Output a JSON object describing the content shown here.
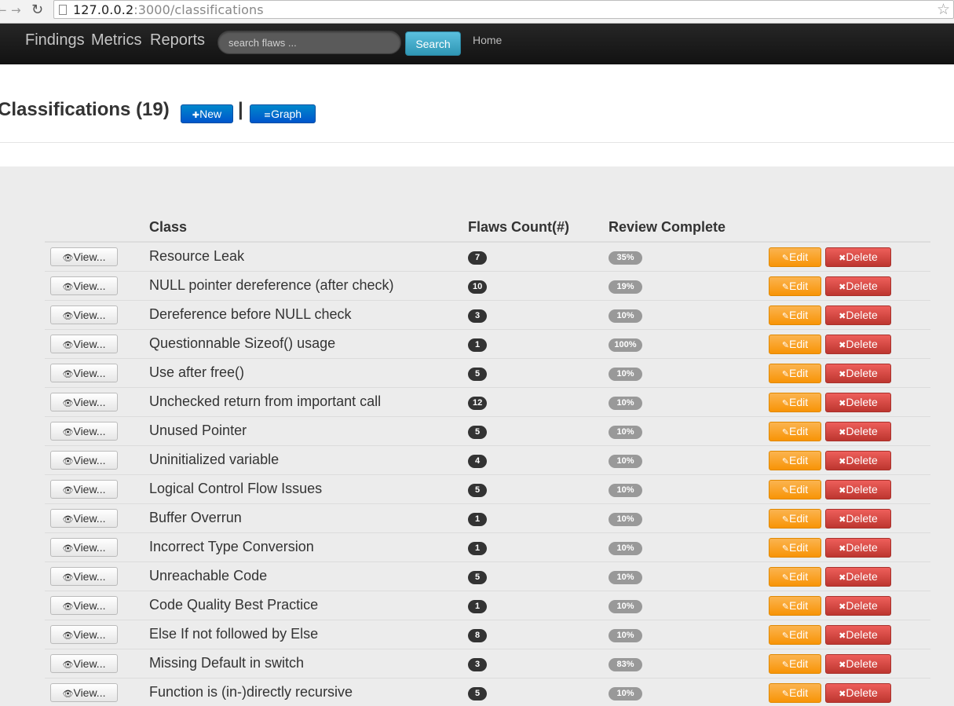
{
  "browser": {
    "url_host": "127.0.0.2",
    "url_rest": ":3000/classifications",
    "back_icon": "back-arrow-icon",
    "forward_icon": "forward-arrow-icon",
    "reload_icon": "reload-icon",
    "bookmark_icon": "star-icon"
  },
  "navbar": {
    "links": [
      "Findings",
      "Metrics",
      "Reports"
    ],
    "search_placeholder": "search flaws ...",
    "search_button": "Search",
    "home": "Home",
    "search_button_color": "#49afcd"
  },
  "header": {
    "title": "Classifications (19)",
    "new_button": "New",
    "separator": "|",
    "graph_button": "Graph",
    "button_color": "#006dcc"
  },
  "table": {
    "columns": [
      "Class",
      "Flaws Count(#)",
      "Review Complete"
    ],
    "view_label": "View...",
    "edit_label": "Edit",
    "delete_label": "Delete",
    "edit_color": "#faa732",
    "delete_color": "#da4f49",
    "rows": [
      {
        "name": "Resource Leak",
        "count": "7",
        "review": "35%"
      },
      {
        "name": "NULL pointer dereference (after check)",
        "count": "10",
        "review": "19%"
      },
      {
        "name": "Dereference before NULL check",
        "count": "3",
        "review": "10%"
      },
      {
        "name": "Questionnable Sizeof() usage",
        "count": "1",
        "review": "100%"
      },
      {
        "name": "Use after free()",
        "count": "5",
        "review": "10%"
      },
      {
        "name": "Unchecked return from important call",
        "count": "12",
        "review": "10%"
      },
      {
        "name": "Unused Pointer",
        "count": "5",
        "review": "10%"
      },
      {
        "name": "Uninitialized variable",
        "count": "4",
        "review": "10%"
      },
      {
        "name": "Logical Control Flow Issues",
        "count": "5",
        "review": "10%"
      },
      {
        "name": "Buffer Overrun",
        "count": "1",
        "review": "10%"
      },
      {
        "name": "Incorrect Type Conversion",
        "count": "1",
        "review": "10%"
      },
      {
        "name": "Unreachable Code",
        "count": "5",
        "review": "10%"
      },
      {
        "name": "Code Quality Best Practice",
        "count": "1",
        "review": "10%"
      },
      {
        "name": "Else If not followed by Else",
        "count": "8",
        "review": "10%"
      },
      {
        "name": "Missing Default in switch",
        "count": "3",
        "review": "83%"
      },
      {
        "name": "Function is (in-)directly recursive",
        "count": "5",
        "review": "10%"
      }
    ]
  }
}
